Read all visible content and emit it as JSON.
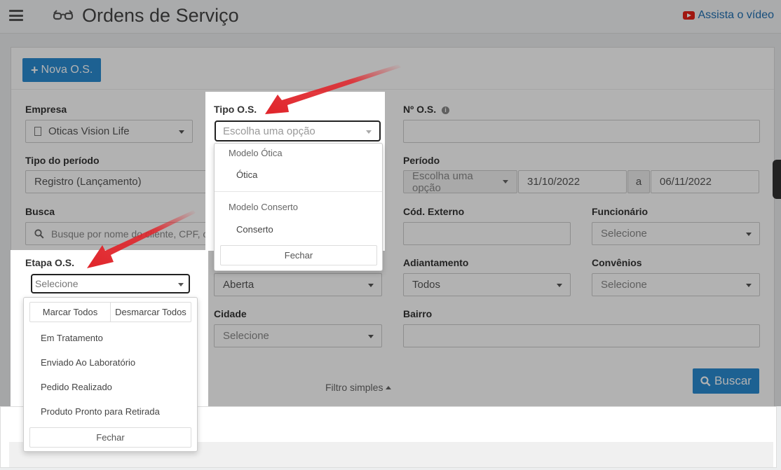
{
  "header": {
    "title": "Ordens de Serviço",
    "video_link": "Assista o vídeo"
  },
  "toolbar": {
    "new_button": "Nova O.S."
  },
  "filters": {
    "empresa": {
      "label": "Empresa",
      "value": "Oticas Vision Life"
    },
    "tipo_os": {
      "label": "Tipo O.S.",
      "placeholder": "Escolha uma opção"
    },
    "numero_os": {
      "label": "Nº O.S."
    },
    "tipo_periodo": {
      "label": "Tipo do período",
      "value": "Registro (Lançamento)"
    },
    "periodo": {
      "label": "Período",
      "mode": "Escolha uma opção",
      "start": "31/10/2022",
      "separator": "a",
      "end": "06/11/2022"
    },
    "busca": {
      "label": "Busca",
      "placeholder": "Busque por nome do cliente,  CPF, c"
    },
    "cod_externo": {
      "label": "Cód. Externo"
    },
    "funcionario": {
      "label": "Funcionário",
      "value": "Selecione"
    },
    "etapa_os": {
      "label": "Etapa O.S.",
      "value": "Selecione"
    },
    "status": {
      "value": "Aberta"
    },
    "adiantamento": {
      "label": "Adiantamento",
      "value": "Todos"
    },
    "convenios": {
      "label": "Convênios",
      "value": "Selecione"
    },
    "cidade": {
      "label": "Cidade",
      "value": "Selecione"
    },
    "bairro": {
      "label": "Bairro"
    }
  },
  "tipo_os_dropdown": {
    "groups": [
      {
        "label": "Modelo Ótica",
        "options": [
          "Ótica"
        ]
      },
      {
        "label": "Modelo Conserto",
        "options": [
          "Conserto"
        ]
      }
    ],
    "close": "Fechar"
  },
  "etapa_dropdown": {
    "select_all": "Marcar Todos",
    "deselect_all": "Desmarcar Todos",
    "options": [
      "Em Tratamento",
      "Enviado Ao Laboratório",
      "Pedido Realizado",
      "Produto Pronto para Retirada"
    ],
    "close": "Fechar"
  },
  "actions": {
    "filter_toggle": "Filtro simples",
    "search_button": "Buscar"
  },
  "colors": {
    "primary": "#2a8bd2",
    "arrow": "#e0242a",
    "youtube": "#e62117"
  }
}
